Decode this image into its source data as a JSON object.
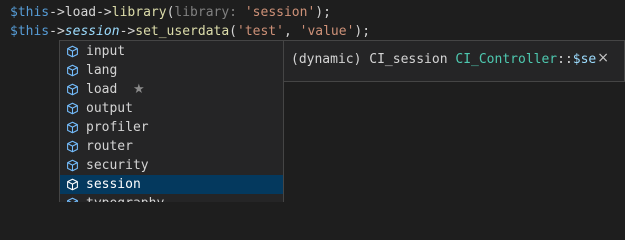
{
  "code": {
    "line1": {
      "var": "$this",
      "arrow1": "->",
      "prop": "load",
      "arrow2": "->",
      "fn": "library",
      "open": "(",
      "param": "library: ",
      "str": "'session'",
      "close": ");"
    },
    "line2": {
      "var": "$this",
      "arrow1": "->",
      "prop": "session",
      "arrow2": "->",
      "fn": "set_userdata",
      "open": "(",
      "str1": "'test'",
      "comma": ", ",
      "str2": "'value'",
      "close": ");"
    }
  },
  "suggestions": {
    "icon": "module-cube-icon",
    "icon_color": "#75beff",
    "items": [
      {
        "label": "input"
      },
      {
        "label": "lang"
      },
      {
        "label": "load",
        "star": "★"
      },
      {
        "label": "output"
      },
      {
        "label": "profiler"
      },
      {
        "label": "router"
      },
      {
        "label": "security"
      },
      {
        "label": "session",
        "selected": true
      },
      {
        "label": "typography"
      }
    ]
  },
  "details": {
    "prefix": "(dynamic) CI_session ",
    "class_name": "CI_Controller",
    "separator": "::",
    "var_name": "$se",
    "close": "×"
  },
  "colors": {
    "background": "#1e1e1e",
    "widget_bg": "#252526",
    "selected_bg": "#04395e",
    "keyword": "#569cd6",
    "function": "#dcdcaa",
    "string": "#ce9178",
    "class": "#4ec9b0"
  }
}
